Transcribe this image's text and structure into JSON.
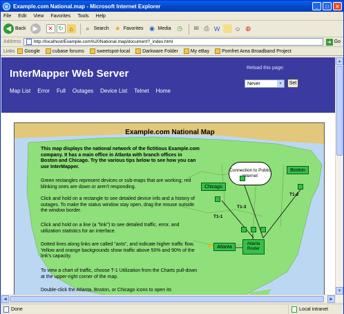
{
  "window": {
    "title": "Example.com National.map - Microsoft Internet Explorer"
  },
  "menu": [
    "File",
    "Edit",
    "View",
    "Favorites",
    "Tools",
    "Help"
  ],
  "toolbar": {
    "back": "Back",
    "search": "Search",
    "favorites": "Favorites",
    "media": "Media"
  },
  "address": {
    "label": "Address",
    "url": "http://localhost/Example.com%20National.map/document?_index.html",
    "go": "Go"
  },
  "links": {
    "label": "Links",
    "items": [
      "Google",
      "cubase forums",
      "sweetspot-local",
      "Darkware Folder",
      "My eBay",
      "Pomfret Area Broadband Project"
    ]
  },
  "page": {
    "brand": "InterMapper Web Server",
    "nav": [
      "Map List",
      "Error",
      "Full",
      "Outages",
      "Device List",
      "Telnet",
      "Home"
    ],
    "reload_label": "Reload this page:",
    "reload_value": "Never",
    "set_button": "Set"
  },
  "map": {
    "title": "Example.com National Map",
    "paragraphs": [
      "This map displays the national network of the fictitious Example.com company. It has a main office in Atlanta with branch offices in Boston and Chicago. Try the various tips below to see how you can use InterMapper.",
      "Green rectangles represent devices or sub-maps that are working; red blinking ones are down or aren't responding.",
      "Click and hold on a rectangle to see detailed device info and a history of outages. To make the status window stay open, drag the mouse outside the window border.",
      "Click and hold on a line (a \"link\") to see detailed traffic, error, and utilization statistics for an interface.",
      "Dotted lines along links are called \"ants\", and indicate higher traffic flow. Yellow and orange backgrounds show traffic above 50% and 90% of the link's capacity.",
      "To view a chart of traffic, choose T-1 Utilization from the Charts pull-down at the upper-right corner of the map.",
      "Double-click the Atlanta, Boston, or Chicago icons to open its"
    ],
    "cloud_label": "Connection to Public Internet",
    "nodes": {
      "chicago": "Chicago",
      "boston": "Boston",
      "atlanta": "Atlanta",
      "atlanta_router": "Atlanta Router"
    },
    "link_labels": [
      "T1-2",
      "T1-3",
      "T1-1"
    ]
  },
  "status": {
    "text": "Done",
    "zone": "Local intranet"
  }
}
